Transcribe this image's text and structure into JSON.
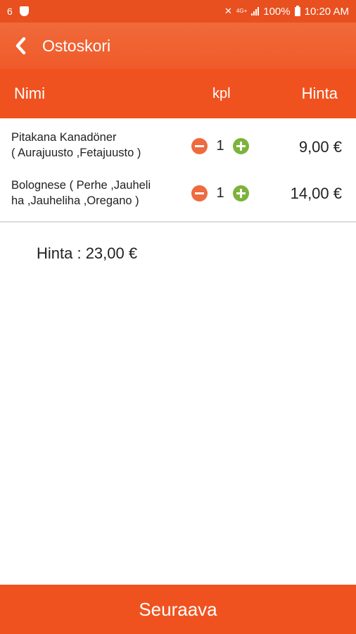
{
  "status_bar": {
    "notification_count": "6",
    "network": "4G+",
    "battery": "100%",
    "time": "10:20 AM"
  },
  "app_bar": {
    "title": "Ostoskori"
  },
  "columns": {
    "name": "Nimi",
    "qty": "kpl",
    "price": "Hinta"
  },
  "items": [
    {
      "name_line1": "Pitakana Kanadöner",
      "name_line2": "( Aurajuusto ,Fetajuusto )",
      "qty": "1",
      "price": "9,00 €"
    },
    {
      "name_line1": "Bolognese ( Perhe ,Jauheli",
      "name_line2": "ha ,Jauheliha ,Oregano )",
      "qty": "1",
      "price": "14,00 €"
    }
  ],
  "total": "Hinta : 23,00 €",
  "next_button": "Seuraava",
  "colors": {
    "accent": "#f0521f",
    "minus": "#ef6a3f",
    "plus": "#7cb33b"
  }
}
